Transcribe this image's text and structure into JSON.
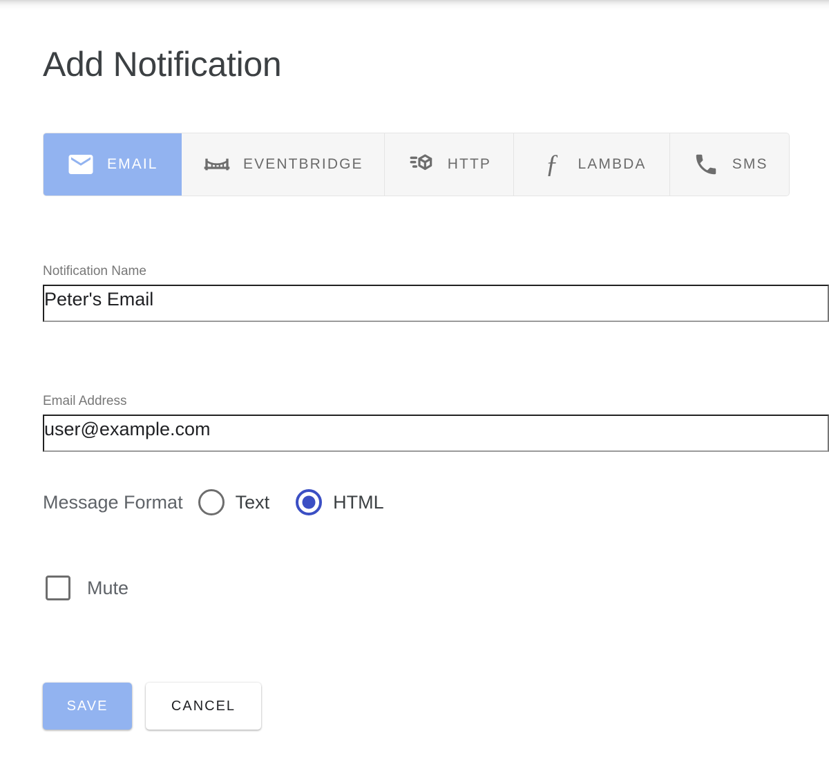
{
  "page": {
    "title": "Add Notification"
  },
  "tabs": {
    "selected": "EMAIL",
    "items": [
      {
        "label": "EMAIL",
        "icon": "envelope-icon",
        "active": true
      },
      {
        "label": "EVENTBRIDGE",
        "icon": "bridge-icon",
        "active": false
      },
      {
        "label": "HTTP",
        "icon": "cube-icon",
        "active": false
      },
      {
        "label": "LAMBDA",
        "icon": "function-icon",
        "active": false
      },
      {
        "label": "SMS",
        "icon": "phone-icon",
        "active": false
      }
    ]
  },
  "form": {
    "notification_name": {
      "label": "Notification Name",
      "value": "Peter's Email",
      "placeholder": "Notification Name"
    },
    "email_address": {
      "label": "Email Address",
      "value": "user@example.com",
      "placeholder": "Email Address"
    },
    "message_format": {
      "caption": "Message Format",
      "selected": "HTML",
      "options": [
        {
          "label": "Text",
          "selected": false
        },
        {
          "label": "HTML",
          "selected": true
        }
      ]
    },
    "mute": {
      "label": "Mute",
      "checked": false
    }
  },
  "actions": {
    "save_label": "SAVE",
    "cancel_label": "CANCEL"
  },
  "colors": {
    "accent_blue": "#92b3f0",
    "radio_blue": "#3b4fc4",
    "title_text": "#3c4043",
    "label_text": "#777777",
    "tab_inactive_bg": "#f6f6f6",
    "underline": "#9a9a9a"
  }
}
